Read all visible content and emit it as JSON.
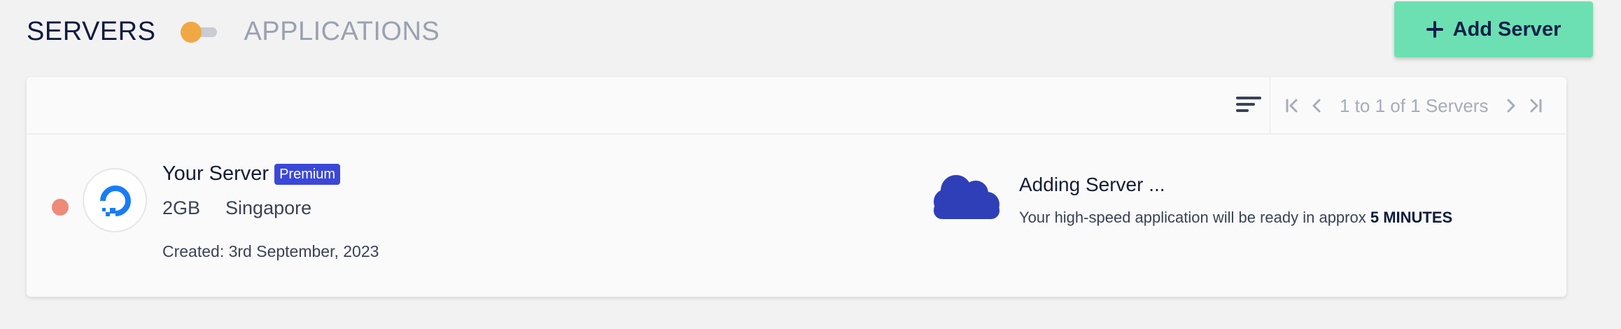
{
  "header": {
    "view_servers_label": "SERVERS",
    "view_applications_label": "APPLICATIONS",
    "add_server_label": "Add Server"
  },
  "toolbar": {
    "pagination_text": "1 to 1 of 1 Servers"
  },
  "server": {
    "name": "Your Server",
    "badge": "Premium",
    "size": "2GB",
    "location": "Singapore",
    "created": "Created: 3rd September, 2023",
    "status": {
      "title": "Adding Server ...",
      "description": "Your high-speed application will be ready in approx",
      "eta": "5 MINUTES"
    }
  },
  "icons": {
    "toggle": "toggle-switch-icon",
    "add": "plus-icon",
    "sort": "sort-icon",
    "first_page": "first-page-icon",
    "prev_page": "chevron-left-icon",
    "next_page": "chevron-right-icon",
    "last_page": "last-page-icon",
    "provider": "digitalocean-logo-icon",
    "status": "cloud-icon"
  },
  "colors": {
    "background": "#f2f2f2",
    "add_button": "#6ce0b2",
    "toggle_knob": "#f0a844",
    "premium_badge": "#3b47d8",
    "status_dot": "#ee8a78",
    "cloud": "#2f3fb8",
    "provider_blue": "#1a7cf4"
  }
}
